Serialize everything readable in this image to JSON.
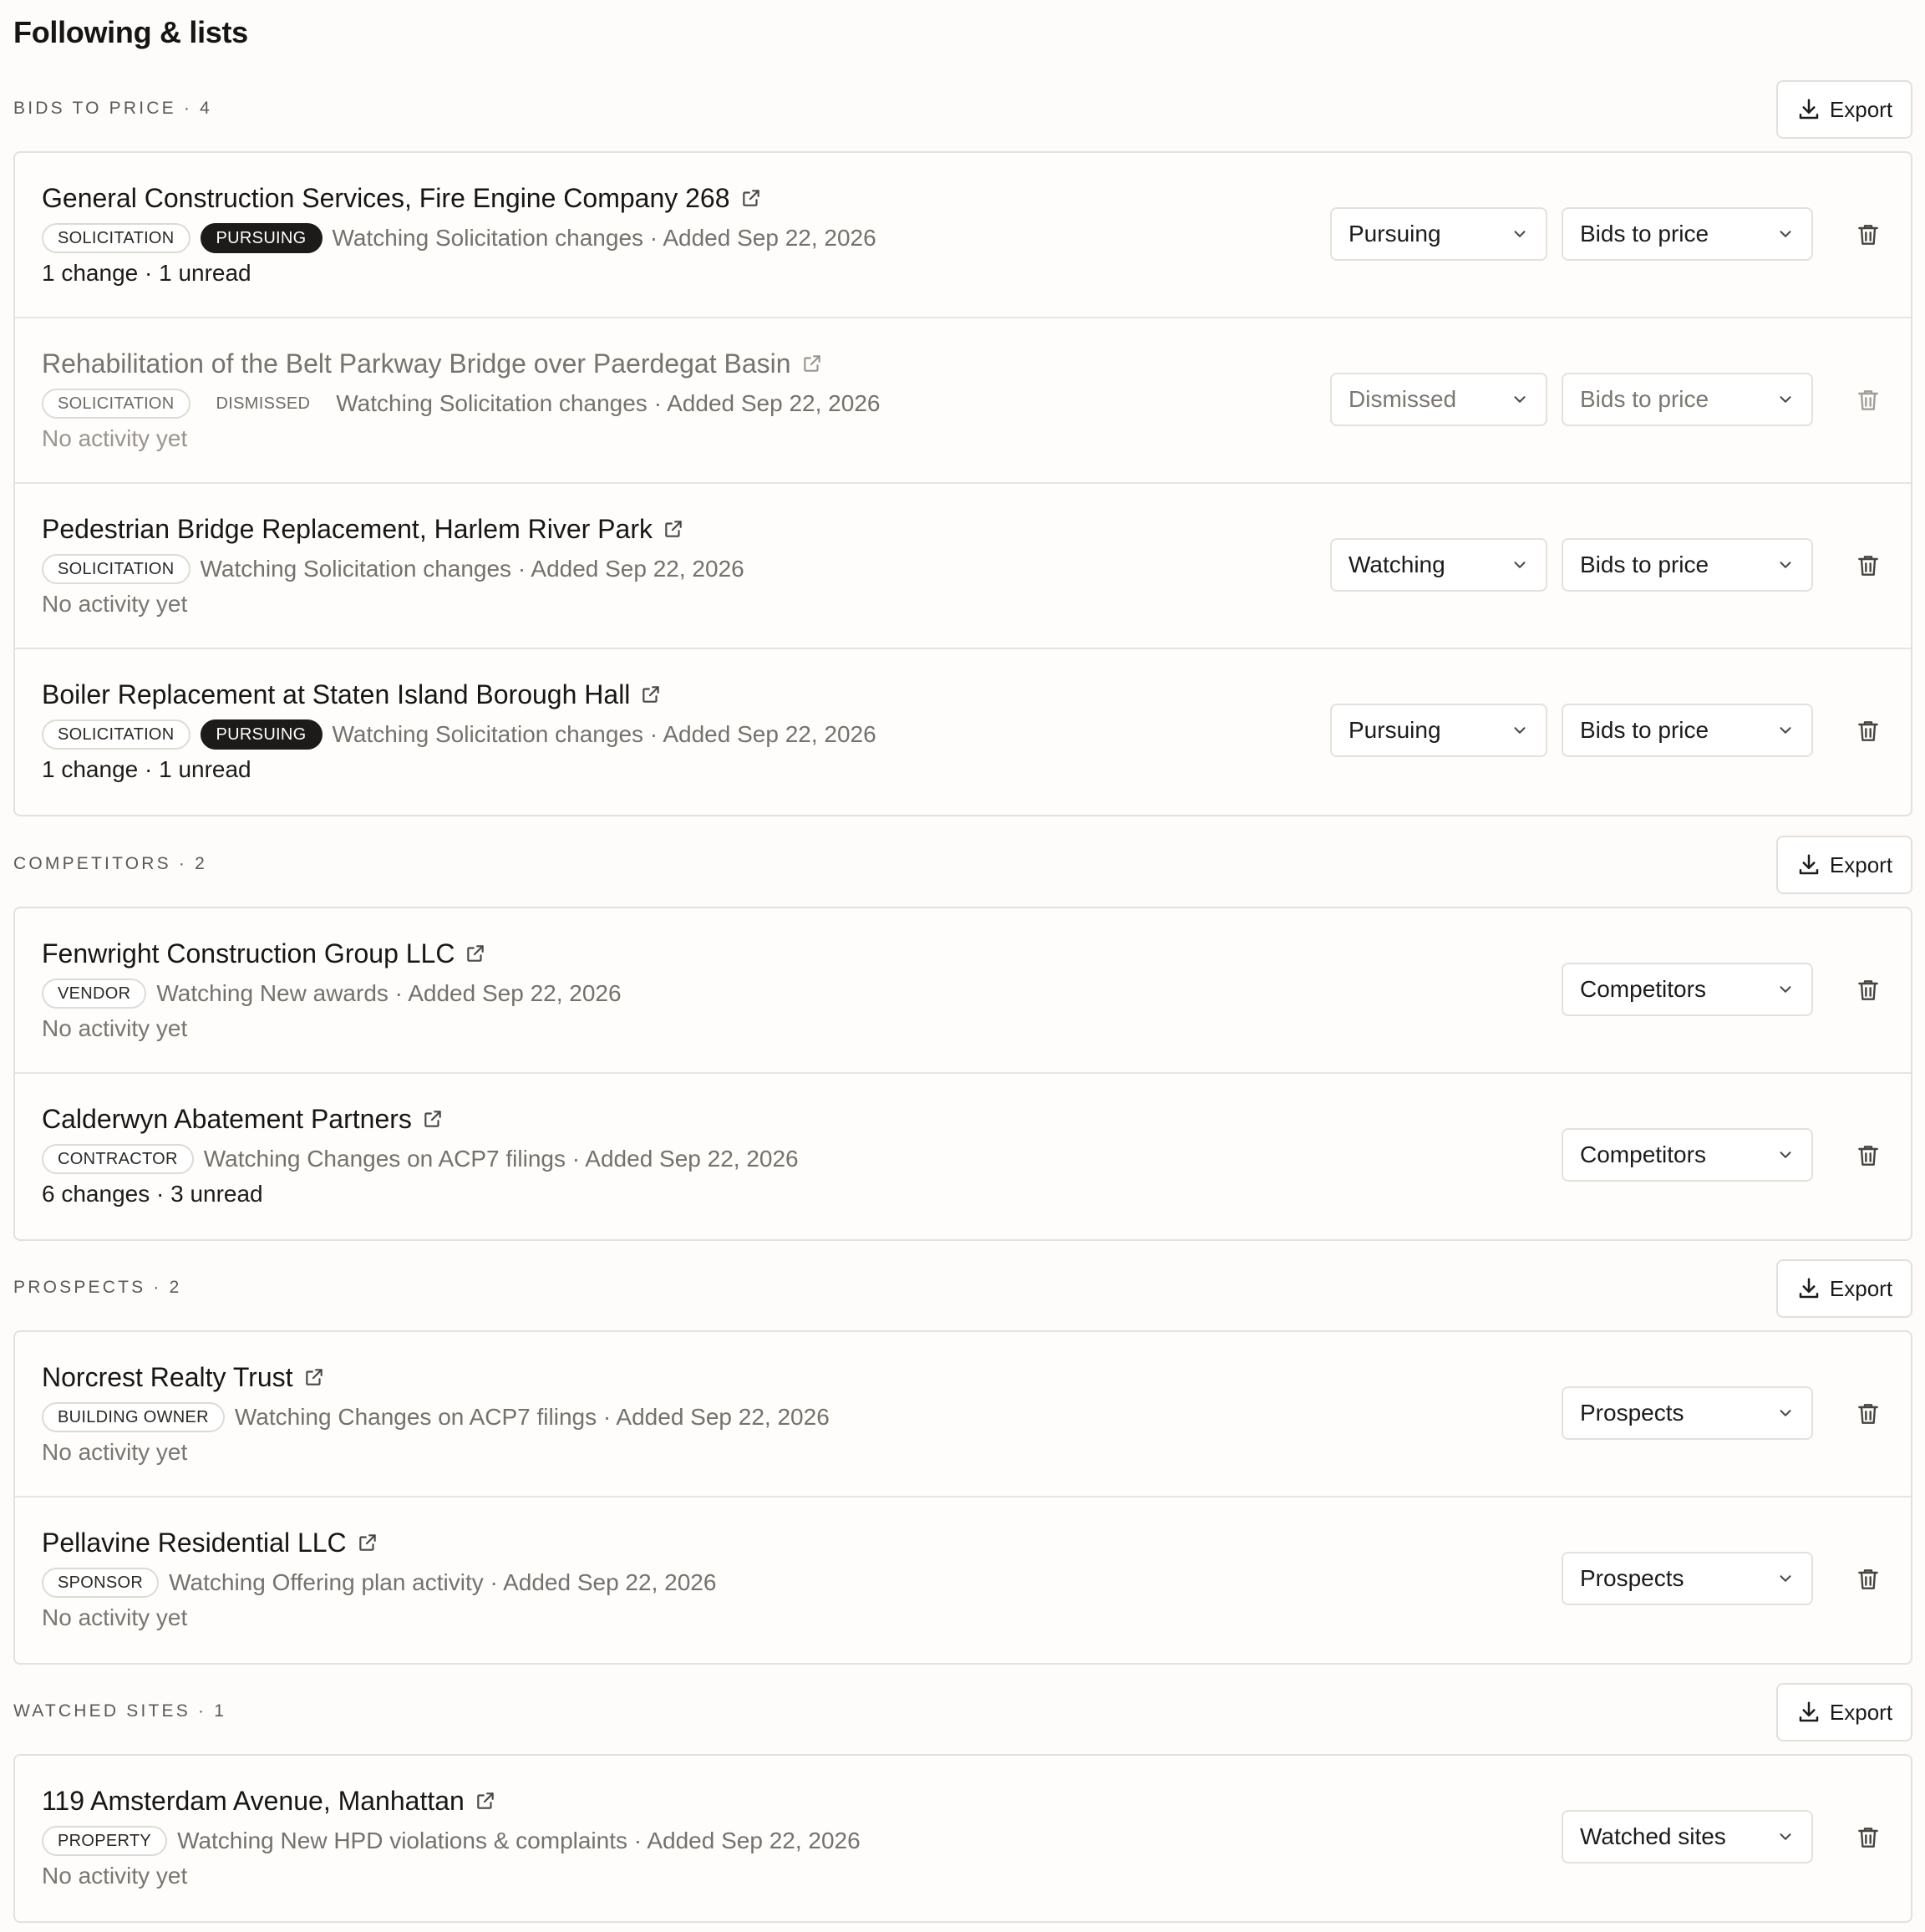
{
  "page": {
    "title": "Following & lists"
  },
  "export_label": "Export",
  "sections": [
    {
      "label": "BIDS TO PRICE · 4",
      "items": [
        {
          "title": "General Construction Services, Fire Engine Company 268",
          "tags": [
            "SOLICITATION",
            "PURSUING"
          ],
          "meta": "Watching Solicitation changes · Added Sep 22, 2026",
          "activity": "1 change · 1 unread",
          "status": "Pursuing",
          "list": "Bids to price"
        },
        {
          "title": "Rehabilitation of the Belt Parkway Bridge over Paerdegat Basin",
          "tags": [
            "SOLICITATION",
            "DISMISSED"
          ],
          "meta": "Watching Solicitation changes · Added Sep 22, 2026",
          "activity": "No activity yet",
          "status": "Dismissed",
          "list": "Bids to price"
        },
        {
          "title": "Pedestrian Bridge Replacement, Harlem River Park",
          "tags": [
            "SOLICITATION"
          ],
          "meta": "Watching Solicitation changes · Added Sep 22, 2026",
          "activity": "No activity yet",
          "status": "Watching",
          "list": "Bids to price"
        },
        {
          "title": "Boiler Replacement at Staten Island Borough Hall",
          "tags": [
            "SOLICITATION",
            "PURSUING"
          ],
          "meta": "Watching Solicitation changes · Added Sep 22, 2026",
          "activity": "1 change · 1 unread",
          "status": "Pursuing",
          "list": "Bids to price"
        }
      ]
    },
    {
      "label": "COMPETITORS · 2",
      "items": [
        {
          "title": "Fenwright Construction Group LLC",
          "tags": [
            "VENDOR"
          ],
          "meta": "Watching New awards · Added Sep 22, 2026",
          "activity": "No activity yet",
          "list": "Competitors"
        },
        {
          "title": "Calderwyn Abatement Partners",
          "tags": [
            "CONTRACTOR"
          ],
          "meta": "Watching Changes on ACP7 filings · Added Sep 22, 2026",
          "activity": "6 changes · 3 unread",
          "list": "Competitors"
        }
      ]
    },
    {
      "label": "PROSPECTS · 2",
      "items": [
        {
          "title": "Norcrest Realty Trust",
          "tags": [
            "BUILDING OWNER"
          ],
          "meta": "Watching Changes on ACP7 filings · Added Sep 22, 2026",
          "activity": "No activity yet",
          "list": "Prospects"
        },
        {
          "title": "Pellavine Residential LLC",
          "tags": [
            "SPONSOR"
          ],
          "meta": "Watching Offering plan activity · Added Sep 22, 2026",
          "activity": "No activity yet",
          "list": "Prospects"
        }
      ]
    },
    {
      "label": "WATCHED SITES · 1",
      "items": [
        {
          "title": "119 Amsterdam Avenue, Manhattan",
          "tags": [
            "PROPERTY"
          ],
          "meta": "Watching New HPD violations & complaints · Added Sep 22, 2026",
          "activity": "No activity yet",
          "list": "Watched sites"
        }
      ]
    }
  ],
  "colors": {
    "background": "#fdfcfb",
    "text": "#1c1b1a",
    "muted": "#75716b",
    "border": "#e4e1dc",
    "pill_dark": "#1c1b1a"
  },
  "icons": {
    "export": "download-icon",
    "title_link": "external-link-icon",
    "select": "chevron-down-icon",
    "delete": "trash-icon"
  }
}
